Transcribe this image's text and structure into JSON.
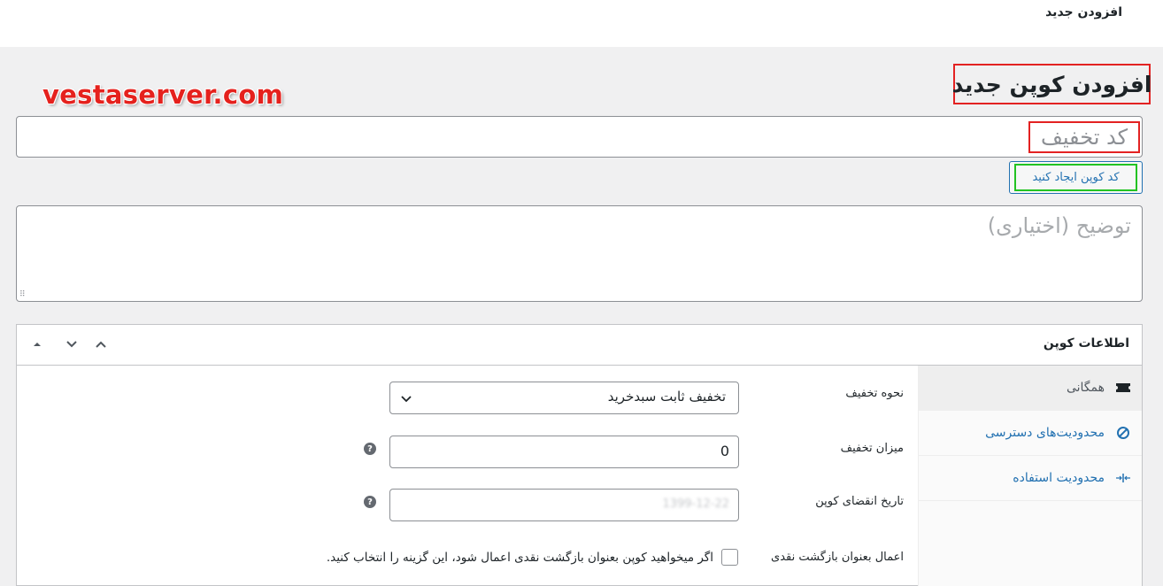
{
  "topbar": {
    "title": "افزودن جدید"
  },
  "watermark": "vestaserver.com",
  "page_title": "افزودن کوپن جدید",
  "coupon_code": {
    "placeholder": "کد تخفیف",
    "value": ""
  },
  "generate_button": {
    "label": "کد کوپن ایجاد کنید"
  },
  "description": {
    "placeholder": "توضیح (اختیاری)",
    "value": ""
  },
  "panel": {
    "title": "اطلاعات کوپن",
    "tabs": [
      {
        "label": "همگانی",
        "icon": "ticket-icon",
        "active": true
      },
      {
        "label": "محدودیت‌های دسترسی",
        "icon": "prohibited-icon",
        "active": false
      },
      {
        "label": "محدودیت استفاده",
        "icon": "limit-arrows-icon",
        "active": false
      }
    ],
    "fields": {
      "discount_type": {
        "label": "نحوه تخفیف",
        "value": "تخفیف ثابت سبدخرید"
      },
      "amount": {
        "label": "میزان تخفیف",
        "value": "0"
      },
      "expiry": {
        "label": "تاریخ انقضای کوپن",
        "placeholder": "1399-12-22"
      },
      "cashback": {
        "label": "اعمال بعنوان بازگشت نقدی",
        "description": "اگر میخواهید کوپن بعنوان بازگشت نقدی اعمال شود، این گزینه را انتخاب کنید.",
        "checked": false
      }
    }
  },
  "colors": {
    "accent": "#2271b1",
    "highlight_red": "#e32222",
    "highlight_green": "#22c322"
  }
}
